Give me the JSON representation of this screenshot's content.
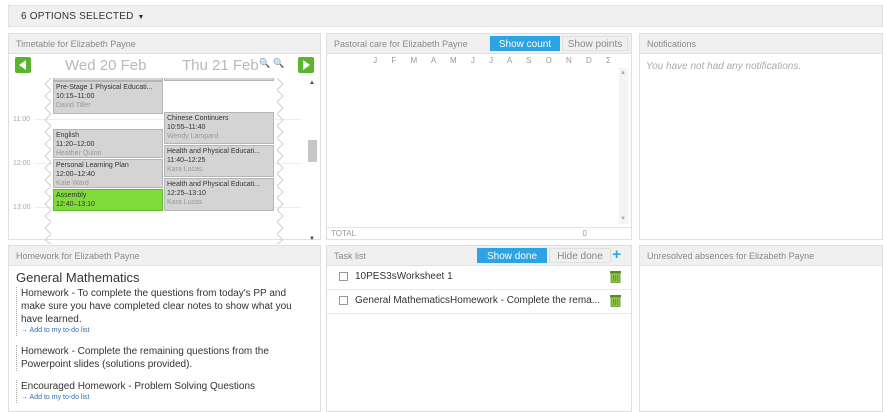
{
  "options_bar": {
    "label": "6 OPTIONS SELECTED"
  },
  "timetable": {
    "title": "Timetable for Elizabeth Payne",
    "day1": "Wed 20 Feb",
    "day2": "Thu 21 Feb",
    "hours": [
      "11:00",
      "12:00",
      "13:00"
    ],
    "day1_events": [
      {
        "title": "Pre-Stage 1 Physical Educati...",
        "time": "10:15–11:00",
        "teacher": "David Tiller",
        "color": "grey"
      },
      {
        "title": "English",
        "time": "11:20–12:00",
        "teacher": "Heather Quinn",
        "color": "grey"
      },
      {
        "title": "Personal Learning Plan",
        "time": "12:00–12:40",
        "teacher": "Kate Ward",
        "color": "grey"
      },
      {
        "title": "Assembly",
        "time": "12:40–13:10",
        "teacher": "",
        "color": "green"
      }
    ],
    "day2_events": [
      {
        "title": "Chinese Continuers",
        "time": "10:55–11:40",
        "teacher": "Wendy Lampard",
        "color": "grey"
      },
      {
        "title": "Health and Physical Educati...",
        "time": "11:40–12:25",
        "teacher": "Kara Lucas",
        "color": "grey"
      },
      {
        "title": "Health and Physical Educati...",
        "time": "12:25–13:10",
        "teacher": "Kara Lucas",
        "color": "grey"
      }
    ]
  },
  "pastoral": {
    "title": "Pastoral care for Elizabeth Payne",
    "show_count": "Show count",
    "show_points": "Show points",
    "months": "J F M A M J J A S O N D Σ",
    "total_label": "TOTAL",
    "total_value": "0"
  },
  "notifications": {
    "title": "Notifications",
    "empty": "You have not had any notifications."
  },
  "homework": {
    "title": "Homework for Elizabeth Payne",
    "subject": "General Mathematics",
    "items": [
      {
        "text": "Homework - To complete the questions from today's PP and make sure you have completed clear notes to show what you have learned.",
        "link": "→ Add to my to-do list"
      },
      {
        "text": "Homework - Complete the remaining questions from the Powerpoint slides (solutions provided).",
        "link": ""
      },
      {
        "text": "Encouraged Homework - Problem Solving Questions",
        "link": "→ Add to my to-do list"
      }
    ]
  },
  "tasklist": {
    "title": "Task list",
    "show_done": "Show done",
    "hide_done": "Hide done",
    "add_icon": "+",
    "tasks": [
      {
        "text": "10PES3sWorksheet 1"
      },
      {
        "text": "General MathematicsHomework - Complete the rema..."
      }
    ]
  },
  "absences": {
    "title": "Unresolved absences for Elizabeth Payne"
  },
  "colors": {
    "accent": "#2ca3e3",
    "nav_green": "#5bb430",
    "event_green": "#7fdc3b",
    "event_grey": "#d4d4d4"
  }
}
